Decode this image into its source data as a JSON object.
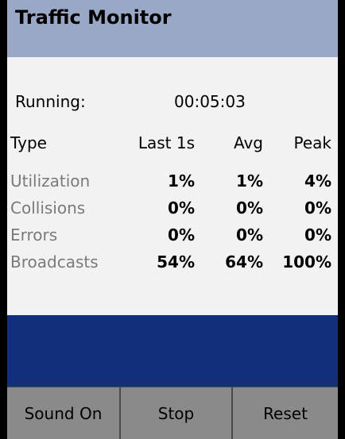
{
  "app": {
    "title": "Traffic Monitor"
  },
  "status": {
    "running_label": "Running:",
    "elapsed": "00:05:03"
  },
  "table": {
    "headers": [
      "Type",
      "Last 1s",
      "Avg",
      "Peak"
    ],
    "rows": [
      {
        "type": "Utilization",
        "last_1s": "1%",
        "avg": "1%",
        "peak": "4%"
      },
      {
        "type": "Collisions",
        "last_1s": "0%",
        "avg": "0%",
        "peak": "0%"
      },
      {
        "type": "Errors",
        "last_1s": "0%",
        "avg": "0%",
        "peak": "0%"
      },
      {
        "type": "Broadcasts",
        "last_1s": "54%",
        "avg": "64%",
        "peak": "100%"
      }
    ]
  },
  "buttons": [
    {
      "label": "Sound On"
    },
    {
      "label": "Stop"
    },
    {
      "label": "Reset"
    }
  ],
  "colors": {
    "title_bar": "#9aa8c8",
    "content_bg": "#f2f2f2",
    "blue_band": "#12307a",
    "button_bg": "#8a8a8a",
    "label_gray": "#7a7a7a"
  }
}
